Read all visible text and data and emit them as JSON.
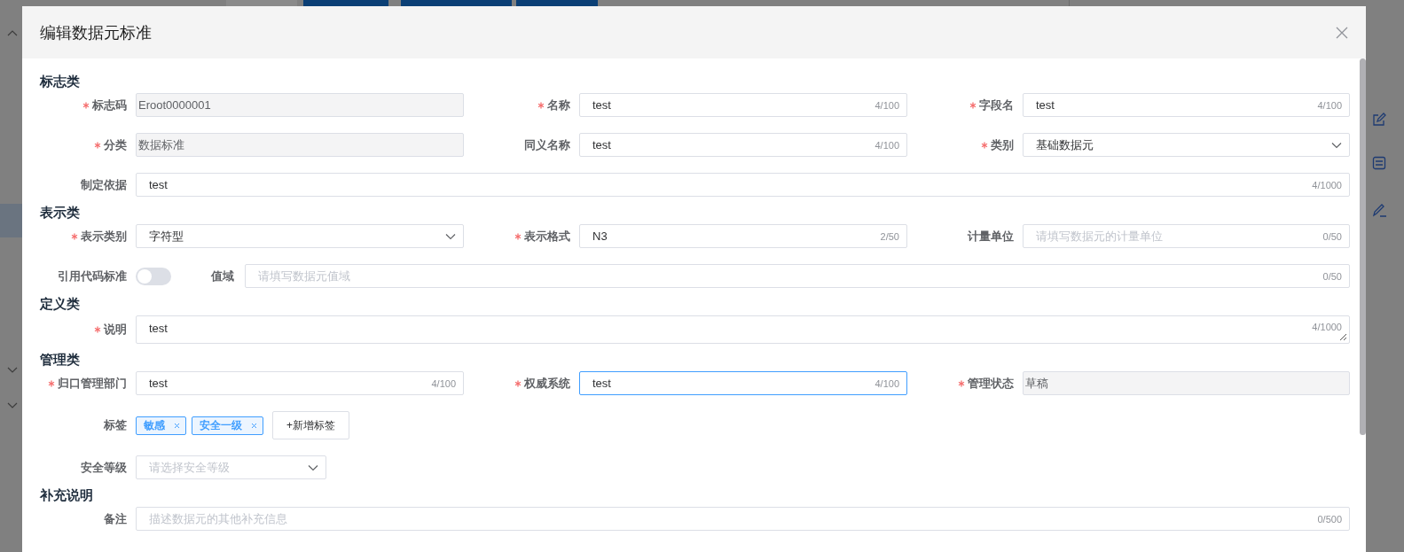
{
  "dialog": {
    "title": "编辑数据元标准"
  },
  "sections": [
    {
      "title": "标志类",
      "rows": [
        {
          "fields": [
            {
              "kind": "input",
              "label": "标志码",
              "required": true,
              "value": "Eroot0000001",
              "disabled": true
            },
            {
              "kind": "input",
              "label": "名称",
              "required": true,
              "value": "test",
              "counter": "4/100"
            },
            {
              "kind": "input",
              "label": "字段名",
              "required": true,
              "value": "test",
              "counter": "4/100"
            }
          ]
        },
        {
          "fields": [
            {
              "kind": "input",
              "label": "分类",
              "required": true,
              "value": "数据标准",
              "disabled": true
            },
            {
              "kind": "input",
              "label": "同义名称",
              "required": false,
              "value": "test",
              "counter": "4/100"
            },
            {
              "kind": "select",
              "label": "类别",
              "required": true,
              "value": "基础数据元"
            }
          ]
        },
        {
          "fields": [
            {
              "kind": "input",
              "label": "制定依据",
              "required": false,
              "value": "test",
              "counter": "4/1000"
            }
          ]
        }
      ]
    },
    {
      "title": "表示类",
      "rows": [
        {
          "fields": [
            {
              "kind": "select",
              "label": "表示类别",
              "required": true,
              "value": "字符型"
            },
            {
              "kind": "input",
              "label": "表示格式",
              "required": true,
              "value": "N3",
              "counter": "2/50"
            },
            {
              "kind": "input",
              "label": "计量单位",
              "required": false,
              "placeholder": "请填写数据元的计量单位",
              "counter": "0/50"
            }
          ]
        },
        {
          "fields": [
            {
              "kind": "switch",
              "label": "引用代码标准",
              "on": false
            },
            {
              "kind": "input",
              "label": "值域",
              "required": false,
              "placeholder": "请填写数据元值域",
              "counter": "0/50"
            }
          ]
        }
      ]
    },
    {
      "title": "定义类",
      "rows": [
        {
          "fields": [
            {
              "kind": "textarea",
              "label": "说明",
              "required": true,
              "value": "test",
              "counter": "4/1000"
            }
          ]
        }
      ]
    },
    {
      "title": "管理类",
      "rows": [
        {
          "fields": [
            {
              "kind": "input",
              "label": "归口管理部门",
              "required": true,
              "value": "test",
              "counter": "4/100"
            },
            {
              "kind": "input",
              "label": "权威系统",
              "required": true,
              "value": "test",
              "counter": "4/100",
              "focused": true
            },
            {
              "kind": "input",
              "label": "管理状态",
              "required": true,
              "value": "草稿",
              "disabled": true
            }
          ]
        },
        {
          "fields": [
            {
              "kind": "tags",
              "label": "标签",
              "tags": [
                "敏感",
                "安全一级"
              ],
              "add_button": "+新增标签"
            }
          ]
        },
        {
          "fields": [
            {
              "kind": "select",
              "label": "安全等级",
              "required": false,
              "placeholder": "请选择安全等级"
            }
          ]
        }
      ]
    },
    {
      "title": "补充说明",
      "rows": [
        {
          "fields": [
            {
              "kind": "input",
              "label": "备注",
              "required": false,
              "placeholder": "描述数据元的其他补充信息",
              "counter": "0/500"
            }
          ]
        }
      ]
    }
  ]
}
